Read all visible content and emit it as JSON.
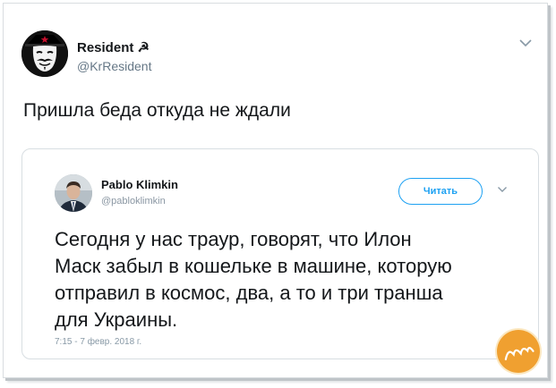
{
  "tweet": {
    "author_name": "Resident ☭",
    "author_handle": "@KrResident",
    "text": "Пришла беда откуда не ждали"
  },
  "quoted_tweet": {
    "author_name": "Pablo Klimkin",
    "author_handle": "@pabloklimkin",
    "follow_label": "Читать",
    "text": "Сегодня у нас траур, говорят, что Илон\nМаск забыл в кошельке в машине, которую\nотправил в космос, два, а то и три транша\nдля Украины.",
    "timestamp": "7:15 - 7 февр. 2018 г."
  },
  "icons": {
    "menu": "chevron-down-icon"
  },
  "colors": {
    "accent": "#1da1f2",
    "text": "#14171a",
    "muted": "#657786",
    "border": "#d8dee2",
    "watermark": "#f0a030"
  }
}
